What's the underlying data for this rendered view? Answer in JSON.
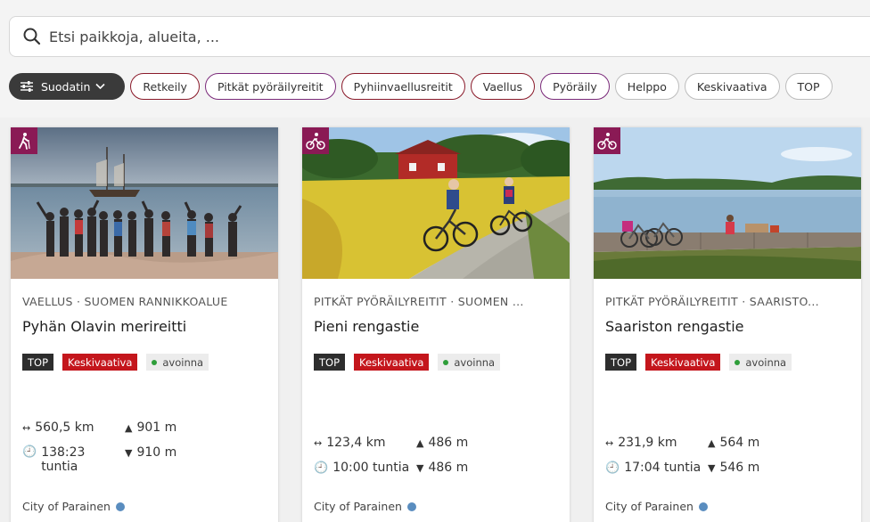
{
  "search": {
    "placeholder": "Etsi paikkoja, alueita, ..."
  },
  "filters": {
    "filter_button": "Suodatin",
    "chips": [
      {
        "label": "Retkeily"
      },
      {
        "label": "Pitkät pyöräilyreitit"
      },
      {
        "label": "Pyhiinvaellusreitit"
      },
      {
        "label": "Vaellus"
      },
      {
        "label": "Pyöräily"
      },
      {
        "label": "Helppo"
      },
      {
        "label": "Keskivaativa"
      },
      {
        "label": "TOP"
      }
    ]
  },
  "cards": [
    {
      "category": "VAELLUS · SUOMEN RANNIKKOALUE",
      "title": "Pyhän Olavin merireitti",
      "badge_top": "TOP",
      "badge_difficulty": "Keskivaativa",
      "badge_status": "avoinna",
      "length": "560,5 km",
      "ascent": "901 m",
      "duration": "138:23 tuntia",
      "descent": "910 m",
      "organization": "City of Parainen",
      "activity_icon": "hiking-icon"
    },
    {
      "category": "PITKÄT PYÖRÄILYREITIT · SUOMEN ...",
      "title": "Pieni rengastie",
      "badge_top": "TOP",
      "badge_difficulty": "Keskivaativa",
      "badge_status": "avoinna",
      "length": "123,4 km",
      "ascent": "486 m",
      "duration": "10:00 tuntia",
      "descent": "486 m",
      "organization": "City of Parainen",
      "activity_icon": "cycling-icon"
    },
    {
      "category": "PITKÄT PYÖRÄILYREITIT · SAARISTO...",
      "title": "Saariston rengastie",
      "badge_top": "TOP",
      "badge_difficulty": "Keskivaativa",
      "badge_status": "avoinna",
      "length": "231,9 km",
      "ascent": "564 m",
      "duration": "17:04 tuntia",
      "descent": "546 m",
      "organization": "City of Parainen",
      "activity_icon": "cycling-icon"
    }
  ]
}
